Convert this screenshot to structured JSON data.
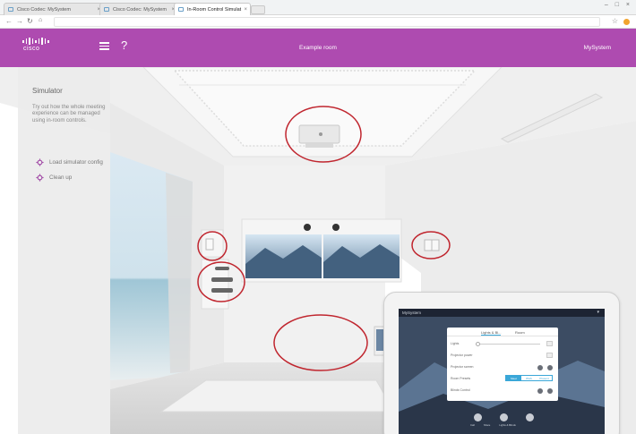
{
  "browser": {
    "tabs": [
      {
        "label": "Cisco Codec: MySystem",
        "active": false
      },
      {
        "label": "Cisco Codec: MySystem",
        "active": false
      },
      {
        "label": "In-Room Control Simulat",
        "active": true
      }
    ],
    "window_controls": "– □ ×"
  },
  "header": {
    "logo_text": "cisco",
    "room_title": "Example room",
    "system_name": "MySystem",
    "help_label": "?"
  },
  "sidebar": {
    "title": "Simulator",
    "description": "Try out how the whole meeting experience can be managed using in-room controls.",
    "items": [
      {
        "label": "Load simulator config",
        "icon": "gear-icon"
      },
      {
        "label": "Clean up",
        "icon": "gear-icon"
      }
    ]
  },
  "tablet": {
    "system_name": "MySystem",
    "panel_tabs": [
      "Lights & Bl...",
      "Room"
    ],
    "rows": [
      {
        "label": "Lights"
      },
      {
        "label": "Projector power"
      },
      {
        "label": "Projector screen"
      },
      {
        "label": "Room Presets"
      },
      {
        "label": "Blinds Control"
      }
    ],
    "presets": [
      "Meet",
      "Work",
      "Present"
    ],
    "active_preset": "Meet",
    "bottom_buttons": [
      "Call",
      "Share",
      "Lights & Blinds"
    ]
  },
  "colors": {
    "brand": "#ae4bb0",
    "hotspot": "#c0262f",
    "accent": "#3aa7d8"
  }
}
